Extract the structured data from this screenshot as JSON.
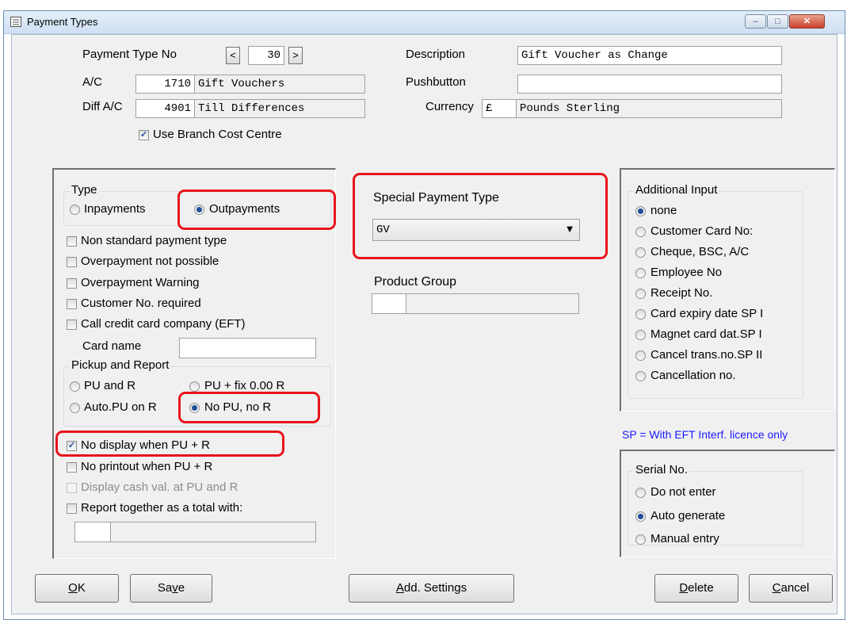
{
  "window": {
    "title": "Payment Types",
    "minimize_glyph": "–",
    "maximize_glyph": "□",
    "close_glyph": "✕"
  },
  "header": {
    "payment_type_no_label": "Payment Type No",
    "prev_label": "<",
    "payment_type_no": "30",
    "next_label": ">",
    "description_label": "Description",
    "description": "Gift Voucher as Change",
    "ac_label": "A/C",
    "ac_number": "1710",
    "ac_name": "Gift Vouchers",
    "pushbutton_label": "Pushbutton",
    "pushbutton": "",
    "diff_ac_label": "Diff A/C",
    "diff_ac_number": "4901",
    "diff_ac_name": "Till Differences",
    "currency_label": "Currency",
    "currency_symbol": "£",
    "currency_name": "Pounds Sterling",
    "branch_cost_centre_label": "Use Branch Cost Centre",
    "branch_cost_centre_checked": true
  },
  "type_group": {
    "title": "Type",
    "inpayments_label": "Inpayments",
    "outpayments_label": "Outpayments",
    "selected": "Outpayments"
  },
  "options": {
    "non_standard": "Non standard payment type",
    "overpayment_not_possible": "Overpayment not possible",
    "overpayment_warning": "Overpayment Warning",
    "customer_no_required": "Customer No. required",
    "call_credit_card": "Call credit card company (EFT)",
    "card_name_label": "Card name",
    "card_name": ""
  },
  "pickup_group": {
    "title": "Pickup and Report",
    "pu_and_r": "PU and R",
    "pu_fix": "PU + fix 0.00 R",
    "auto_pu": "Auto.PU on R",
    "no_pu_no_r": "No PU, no R",
    "selected": "No PU, no R"
  },
  "report_options": {
    "no_display": "No display when PU + R",
    "no_display_checked": true,
    "no_printout": "No printout when PU + R",
    "display_cash": "Display cash val. at PU and R",
    "report_together": "Report together as a total with:"
  },
  "special_payment": {
    "label": "Special Payment Type",
    "value": "GV",
    "arrow": "▼"
  },
  "product_group": {
    "label": "Product Group"
  },
  "additional_input": {
    "title": "Additional Input",
    "items": [
      "none",
      "Customer Card No:",
      "Cheque, BSC, A/C",
      "Employee No",
      "Receipt No.",
      "Card expiry date SP I",
      "Magnet card dat.SP I",
      "Cancel trans.no.SP II",
      "Cancellation no."
    ],
    "selected_index": 0,
    "note": "SP = With EFT Interf. licence only"
  },
  "serial_no": {
    "title": "Serial No.",
    "items": [
      "Do not enter",
      "Auto generate",
      "Manual entry"
    ],
    "selected_index": 1
  },
  "buttons": {
    "ok_u": "O",
    "ok_rest": "K",
    "save_a": "Sa",
    "save_u": "v",
    "save_b": "e",
    "add_u": "A",
    "add_rest": "dd. Settings",
    "delete_u": "D",
    "delete_rest": "elete",
    "cancel_u": "C",
    "cancel_rest": "ancel"
  },
  "colors": {
    "highlight": "#e8141b",
    "note_blue": "#1a1aff",
    "title_bar": "#dbe8f6"
  }
}
